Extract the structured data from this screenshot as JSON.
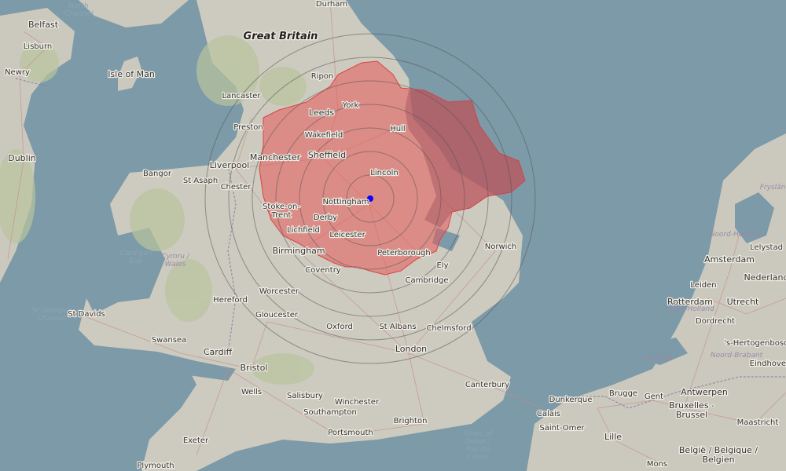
{
  "map": {
    "center_marker": {
      "label": "",
      "color": "#0b00ff"
    },
    "coverage_color": "#e85a5a",
    "range_ring_count": 7,
    "regions": [
      {
        "key": "great_britain",
        "text": "Great Britain"
      }
    ],
    "water_labels": [
      {
        "key": "north_channel",
        "text": "North Channel"
      },
      {
        "key": "st_georges",
        "text": "St George's Channel"
      },
      {
        "key": "cardigan_bay",
        "text": "Cardigan Bay"
      },
      {
        "key": "strait_dover",
        "text": "Strait of Dover / Pas de Calais"
      }
    ],
    "province_labels": [
      {
        "key": "cymru",
        "text": "Cymru / Wales"
      },
      {
        "key": "frysland",
        "text": "Fryslân"
      },
      {
        "key": "noord_holland",
        "text": "Noord-Holland"
      },
      {
        "key": "zuid_holland",
        "text": "Zuid-Holland"
      },
      {
        "key": "zeeland",
        "text": "Zeeland"
      },
      {
        "key": "noord_brabant",
        "text": "Noord-Brabant"
      }
    ],
    "places": [
      {
        "key": "belfast",
        "text": "Belfast"
      },
      {
        "key": "lisburn",
        "text": "Lisburn"
      },
      {
        "key": "newry",
        "text": "Newry"
      },
      {
        "key": "isle_of_man",
        "text": "Isle of Man"
      },
      {
        "key": "dublin",
        "text": "Dublin"
      },
      {
        "key": "durham",
        "text": "Durham"
      },
      {
        "key": "ripon",
        "text": "Ripon"
      },
      {
        "key": "lancaster",
        "text": "Lancaster"
      },
      {
        "key": "york",
        "text": "York"
      },
      {
        "key": "preston",
        "text": "Preston"
      },
      {
        "key": "leeds",
        "text": "Leeds"
      },
      {
        "key": "hull",
        "text": "Hull"
      },
      {
        "key": "wakefield",
        "text": "Wakefield"
      },
      {
        "key": "manchester",
        "text": "Manchester"
      },
      {
        "key": "liverpool",
        "text": "Liverpool"
      },
      {
        "key": "sheffield",
        "text": "Sheffield"
      },
      {
        "key": "bangor",
        "text": "Bangor"
      },
      {
        "key": "st_asaph",
        "text": "St Asaph"
      },
      {
        "key": "chester",
        "text": "Chester"
      },
      {
        "key": "lincoln",
        "text": "Lincoln"
      },
      {
        "key": "nottingham",
        "text": "Nottingham"
      },
      {
        "key": "stoke",
        "text": "Stoke-on-Trent"
      },
      {
        "key": "derby",
        "text": "Derby"
      },
      {
        "key": "lichfield",
        "text": "Lichfield"
      },
      {
        "key": "leicester",
        "text": "Leicester"
      },
      {
        "key": "norwich",
        "text": "Norwich"
      },
      {
        "key": "birmingham",
        "text": "Birmingham"
      },
      {
        "key": "peterborough",
        "text": "Peterborough"
      },
      {
        "key": "ely",
        "text": "Ely"
      },
      {
        "key": "coventry",
        "text": "Coventry"
      },
      {
        "key": "cambridge",
        "text": "Cambridge"
      },
      {
        "key": "worcester",
        "text": "Worcester"
      },
      {
        "key": "hereford",
        "text": "Hereford"
      },
      {
        "key": "st_davids",
        "text": "St Davids"
      },
      {
        "key": "gloucester",
        "text": "Gloucester"
      },
      {
        "key": "oxford",
        "text": "Oxford"
      },
      {
        "key": "st_albans",
        "text": "St Albans"
      },
      {
        "key": "chelmsford",
        "text": "Chelmsford"
      },
      {
        "key": "swansea",
        "text": "Swansea"
      },
      {
        "key": "cardiff",
        "text": "Cardiff"
      },
      {
        "key": "london",
        "text": "London"
      },
      {
        "key": "bristol",
        "text": "Bristol"
      },
      {
        "key": "canterbury",
        "text": "Canterbury"
      },
      {
        "key": "wells",
        "text": "Wells"
      },
      {
        "key": "salisbury",
        "text": "Salisbury"
      },
      {
        "key": "winchester",
        "text": "Winchester"
      },
      {
        "key": "southampton",
        "text": "Southampton"
      },
      {
        "key": "brighton",
        "text": "Brighton"
      },
      {
        "key": "portsmouth",
        "text": "Portsmouth"
      },
      {
        "key": "exeter",
        "text": "Exeter"
      },
      {
        "key": "plymouth",
        "text": "Plymouth"
      },
      {
        "key": "amsterdam",
        "text": "Amsterdam"
      },
      {
        "key": "lelystad",
        "text": "Lelystad"
      },
      {
        "key": "nederland",
        "text": "Nederland"
      },
      {
        "key": "leiden",
        "text": "Leiden"
      },
      {
        "key": "utrecht",
        "text": "Utrecht"
      },
      {
        "key": "rotterdam",
        "text": "Rotterdam"
      },
      {
        "key": "dordrecht",
        "text": "Dordrecht"
      },
      {
        "key": "s_hertogenbosch",
        "text": "'s-Hertogenbosch"
      },
      {
        "key": "eindhoven",
        "text": "Eindhoven"
      },
      {
        "key": "dunkerque",
        "text": "Dunkerque"
      },
      {
        "key": "brugge",
        "text": "Brugge"
      },
      {
        "key": "gent",
        "text": "Gent"
      },
      {
        "key": "antwerpen",
        "text": "Antwerpen"
      },
      {
        "key": "bruxelles",
        "text": "Bruxelles - Brussel"
      },
      {
        "key": "calais",
        "text": "Calais"
      },
      {
        "key": "saint_omer",
        "text": "Saint-Omer"
      },
      {
        "key": "lille",
        "text": "Lille"
      },
      {
        "key": "maastricht",
        "text": "Maastricht"
      },
      {
        "key": "mons",
        "text": "Mons"
      },
      {
        "key": "belgie",
        "text": "België / Belgique / Belgien"
      }
    ]
  }
}
